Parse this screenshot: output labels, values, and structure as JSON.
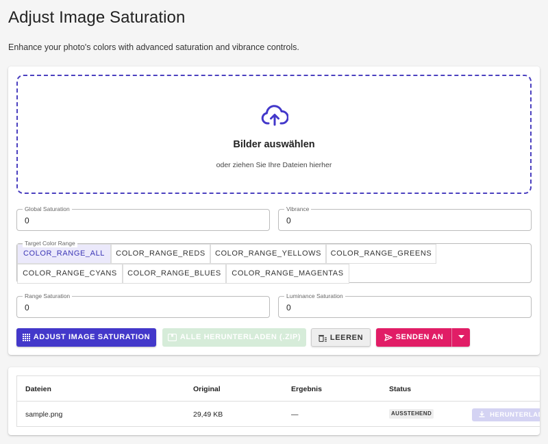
{
  "page": {
    "title": "Adjust Image Saturation",
    "subtitle": "Enhance your photo's colors with advanced saturation and vibrance controls."
  },
  "dropzone": {
    "title": "Bilder auswählen",
    "subtitle": "oder ziehen Sie Ihre Dateien hierher",
    "icon": "cloud-upload-icon"
  },
  "fields": {
    "global_saturation": {
      "label": "Global Saturation",
      "value": "0"
    },
    "vibrance": {
      "label": "Vibrance",
      "value": "0"
    },
    "range_saturation": {
      "label": "Range Saturation",
      "value": "0"
    },
    "luminance_saturation": {
      "label": "Luminance Saturation",
      "value": "0"
    }
  },
  "color_range": {
    "label": "Target Color Range",
    "selected": "COLOR_RANGE_ALL",
    "options": [
      "COLOR_RANGE_ALL",
      "COLOR_RANGE_REDS",
      "COLOR_RANGE_YELLOWS",
      "COLOR_RANGE_GREENS",
      "COLOR_RANGE_CYANS",
      "COLOR_RANGE_BLUES",
      "COLOR_RANGE_MAGENTAS"
    ]
  },
  "actions": {
    "adjust": "ADJUST IMAGE SATURATION",
    "download_all": "ALLE HERUNTERLADEN (.ZIP)",
    "clear": "LEEREN",
    "send_to": "SENDEN AN"
  },
  "table": {
    "headers": [
      "Dateien",
      "Original",
      "Ergebnis",
      "Status"
    ],
    "rows": [
      {
        "file": "sample.png",
        "original": "29,49 KB",
        "result": "—",
        "status": "AUSSTEHEND",
        "download": "HERUNTERLADEN"
      }
    ]
  },
  "colors": {
    "primary": "#4338ca",
    "accent": "#e11d66",
    "zip_disabled": "#d6ecd9",
    "download_disabled": "#d4d3f3"
  }
}
